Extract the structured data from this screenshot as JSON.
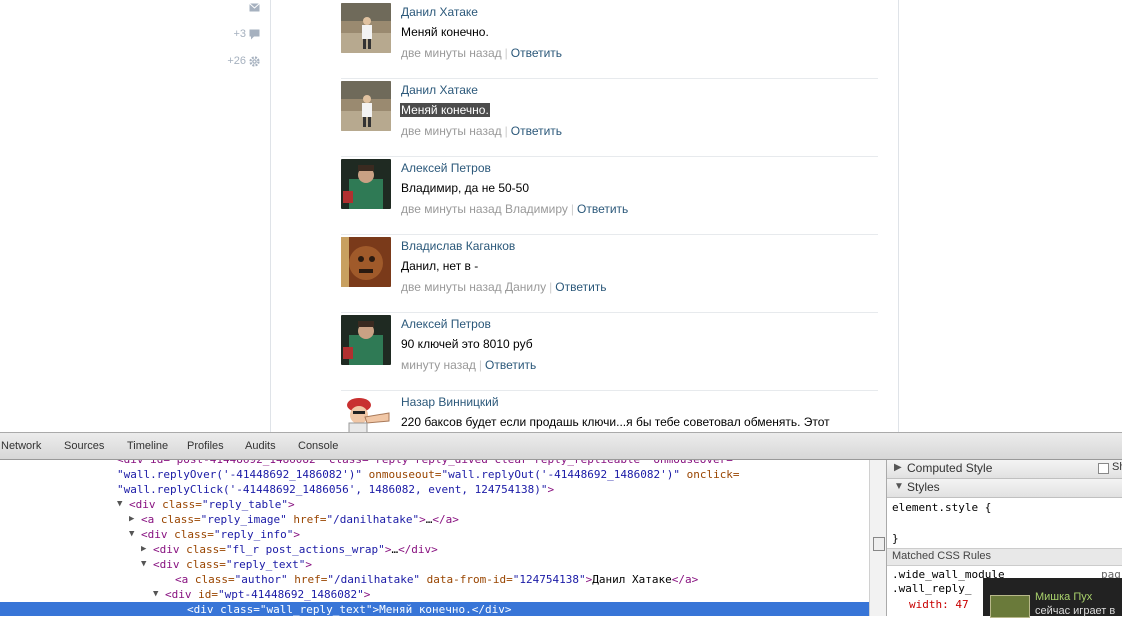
{
  "sidebar": {
    "rows": [
      {
        "count": "",
        "icon": "mail-icon"
      },
      {
        "count": "+3",
        "icon": "comment-icon"
      },
      {
        "count": "+26",
        "icon": "gear-icon"
      }
    ]
  },
  "replies": [
    {
      "author": "Данил Хатаке",
      "text": "Меняй конечно.",
      "time": "две минуты назад",
      "to": "",
      "reply_label": "Ответить",
      "selected": false
    },
    {
      "author": "Данил Хатаке",
      "text": "Меняй конечно.",
      "time": "две минуты назад",
      "to": "",
      "reply_label": "Ответить",
      "selected": true
    },
    {
      "author": "Алексей Петров",
      "text": "Владимир, да не 50-50",
      "time": "две минуты назад",
      "to": "Владимиру",
      "reply_label": "Ответить",
      "selected": false
    },
    {
      "author": "Владислав Каганков",
      "text": "Данил, нет в -",
      "time": "две минуты назад",
      "to": "Данилу",
      "reply_label": "Ответить",
      "selected": false
    },
    {
      "author": "Алексей Петров",
      "text": "90 ключей это 8010 руб",
      "time": "минуту назад",
      "to": "",
      "reply_label": "Ответить",
      "selected": false
    },
    {
      "author": "Назар Винницкий",
      "text": "220 баксов будет если продашь ключи...я бы тебе советовал обменять. Этот",
      "time": "",
      "to": "",
      "reply_label": "",
      "selected": false
    }
  ],
  "devtools": {
    "tabs": [
      "Network",
      "Sources",
      "Timeline",
      "Profiles",
      "Audits",
      "Console"
    ],
    "dom_lines": [
      {
        "indent": 117,
        "tri": "",
        "html": "<span class='av'>\"wall.replyOver('-41448692_1486082')\"</span><span class='an'> onmouseout=</span><span class='av'>\"wall.replyOut('-41448692_1486082')\"</span><span class='an'> onclick=</span>",
        "selected": false
      },
      {
        "indent": 117,
        "tri": "",
        "html": "<span class='av'>\"wall.replyClick('-41448692_1486056', 1486082, event, 124754138)\"</span><span class='t'>&gt;</span>",
        "selected": false
      },
      {
        "indent": 129,
        "tri": "▼",
        "html": "<span class='t'>&lt;div</span><span class='an'> class=</span><span class='av'>\"reply_table\"</span><span class='t'>&gt;</span>",
        "selected": false
      },
      {
        "indent": 141,
        "tri": "▶",
        "html": "<span class='t'>&lt;a</span><span class='an'> class=</span><span class='av'>\"reply_image\"</span><span class='an'> href=</span><span class='av'>\"/danilhatake\"</span><span class='t'>&gt;</span><span class='tx'>…</span><span class='t'>&lt;/a&gt;</span>",
        "selected": false
      },
      {
        "indent": 141,
        "tri": "▼",
        "html": "<span class='t'>&lt;div</span><span class='an'> class=</span><span class='av'>\"reply_info\"</span><span class='t'>&gt;</span>",
        "selected": false
      },
      {
        "indent": 153,
        "tri": "▶",
        "html": "<span class='t'>&lt;div</span><span class='an'> class=</span><span class='av'>\"fl_r post_actions_wrap\"</span><span class='t'>&gt;</span><span class='tx'>…</span><span class='t'>&lt;/div&gt;</span>",
        "selected": false
      },
      {
        "indent": 153,
        "tri": "▼",
        "html": "<span class='t'>&lt;div</span><span class='an'> class=</span><span class='av'>\"reply_text\"</span><span class='t'>&gt;</span>",
        "selected": false
      },
      {
        "indent": 175,
        "tri": "",
        "html": "<span class='t'>&lt;a</span><span class='an'> class=</span><span class='av'>\"author\"</span><span class='an'> href=</span><span class='av'>\"/danilhatake\"</span><span class='an'> data-from-id=</span><span class='av'>\"124754138\"</span><span class='t'>&gt;</span><span class='tx'>Данил Хатаке</span><span class='t'>&lt;/a&gt;</span>",
        "selected": false
      },
      {
        "indent": 165,
        "tri": "▼",
        "html": "<span class='t'>&lt;div</span><span class='an'> id=</span><span class='av'>\"wpt-41448692_1486082\"</span><span class='t'>&gt;</span>",
        "selected": false
      },
      {
        "indent": 187,
        "tri": "",
        "html": "<span class='t'>&lt;div</span><span class='an'> class=</span><span class='av'>\"wall_reply_text\"</span><span class='t'>&gt;</span><span class='tx'>Меняй конечно.</span><span class='t'>&lt;/div&gt;</span>",
        "selected": true
      }
    ],
    "styles": {
      "computed_label": "Computed Style",
      "show_label": "Sh",
      "styles_label": "Styles",
      "element_style_open": "element.style {",
      "element_style_close": "}",
      "matched_label": "Matched CSS Rules",
      "rule1": ".wide_wall_module",
      "rule1_right": "pag",
      "rule2": ".wall_reply_",
      "prop_line": "width: 47"
    }
  },
  "notification": {
    "name": "Мишка Пух",
    "text": "сейчас играет в"
  }
}
